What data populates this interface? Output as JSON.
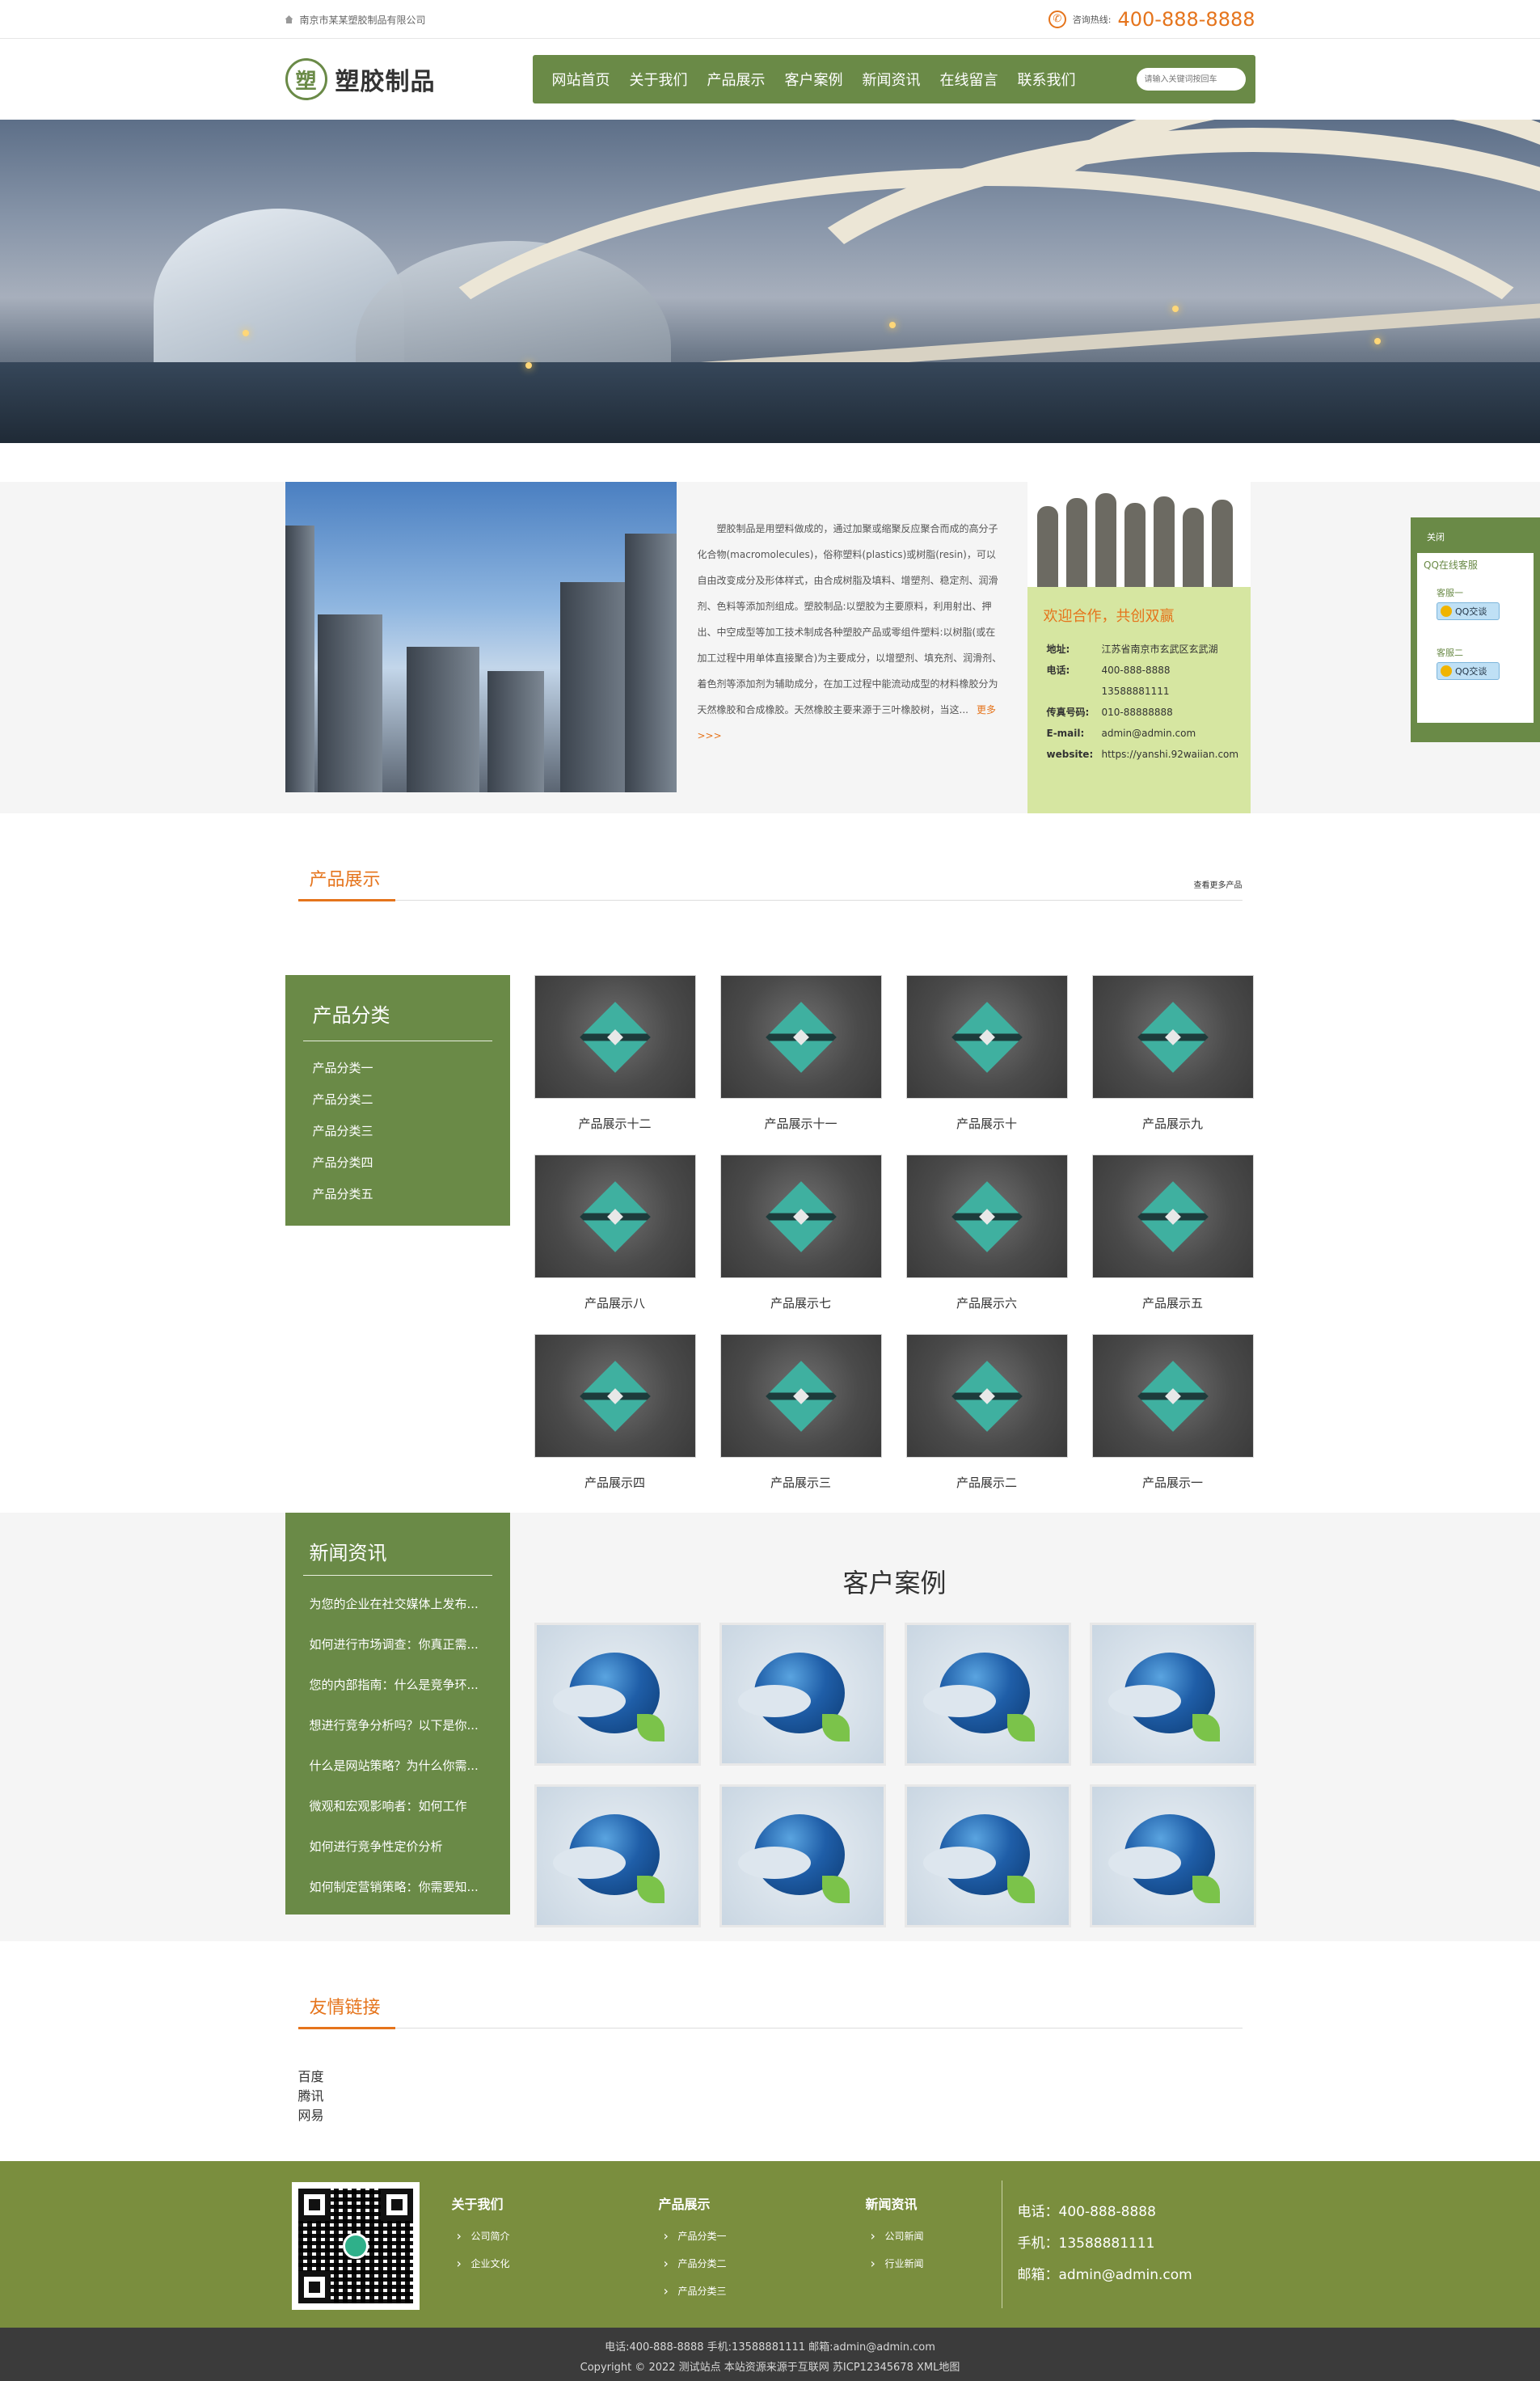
{
  "topbar": {
    "company": "南京市某某塑胶制品有限公司",
    "hotline_label": "咨询热线:",
    "hotline": "400-888-8888"
  },
  "header": {
    "logo_mark": "塑",
    "logo_text": "塑胶制品",
    "nav": [
      "网站首页",
      "关于我们",
      "产品展示",
      "客户案例",
      "新闻资讯",
      "在线留言",
      "联系我们"
    ],
    "search_placeholder": "请输入关键词按回车"
  },
  "about": {
    "text": "塑胶制品是用塑料做成的，通过加聚或缩聚反应聚合而成的高分子化合物(macromolecules)，俗称塑料(plastics)或树脂(resin)，可以自由改变成分及形体样式，由合成树脂及填料、增塑剂、稳定剂、润滑剂、色料等添加剂组成。塑胶制品:以塑胶为主要原料，利用射出、押出、中空成型等加工技术制成各种塑胶产品或零组件塑料:以树脂(或在加工过程中用单体直接聚合)为主要成分，以增塑剂、填充剂、润滑剂、着色剂等添加剂为辅助成分，在加工过程中能流动成型的材料橡胶分为天然橡胶和合成橡胶。天然橡胶主要来源于三叶橡胶树，当这...",
    "more": "更多>>>",
    "contact_title": "欢迎合作，共创双赢",
    "contact": [
      {
        "k": "地址:",
        "v": "江苏省南京市玄武区玄武湖"
      },
      {
        "k": "电话:",
        "v": "400-888-8888"
      },
      {
        "k": "",
        "v": "13588881111"
      },
      {
        "k": "传真号码:",
        "v": "010-88888888"
      },
      {
        "k": "E-mail:",
        "v": "admin@admin.com"
      },
      {
        "k": "website:",
        "v": "https://yanshi.92waiian.com"
      }
    ]
  },
  "qq": {
    "close": "关闭",
    "title": "QQ在线客服",
    "agents": [
      {
        "name": "客服一",
        "btn": "QQ交谈"
      },
      {
        "name": "客服二",
        "btn": "QQ交谈"
      }
    ]
  },
  "products": {
    "title": "产品展示",
    "more": "查看更多产品",
    "cat_title": "产品分类",
    "categories": [
      "产品分类一",
      "产品分类二",
      "产品分类三",
      "产品分类四",
      "产品分类五"
    ],
    "items": [
      "产品展示十二",
      "产品展示十一",
      "产品展示十",
      "产品展示九",
      "产品展示八",
      "产品展示七",
      "产品展示六",
      "产品展示五",
      "产品展示四",
      "产品展示三",
      "产品展示二",
      "产品展示一"
    ]
  },
  "news": {
    "title": "新闻资讯",
    "items": [
      "为您的企业在社交媒体上发布...",
      "如何进行市场调查：你真正需...",
      "您的内部指南：什么是竞争环...",
      "想进行竞争分析吗？以下是你...",
      "什么是网站策略？为什么你需...",
      "微观和宏观影响者：如何工作",
      "如何进行竞争性定价分析",
      "如何制定营销策略：你需要知..."
    ]
  },
  "cases": {
    "title": "客户案例",
    "count": 8
  },
  "links": {
    "title": "友情链接",
    "items": [
      "百度",
      "腾讯",
      "网易"
    ]
  },
  "footer": {
    "cols": [
      {
        "title": "关于我们",
        "items": [
          "公司简介",
          "企业文化"
        ]
      },
      {
        "title": "产品展示",
        "items": [
          "产品分类一",
          "产品分类二",
          "产品分类三"
        ]
      },
      {
        "title": "新闻资讯",
        "items": [
          "公司新闻",
          "行业新闻"
        ]
      }
    ],
    "phone": "电话：400-888-8888",
    "mobile": "手机：13588881111",
    "email": "邮箱：admin@admin.com",
    "bottom_line1": "电话:400-888-8888  手机:13588881111  邮箱:admin@admin.com",
    "bottom_line2": "Copyright © 2022 测试站点 本站资源来源于互联网  苏ICP12345678  XML地图"
  },
  "colors": {
    "primary": "#6a8a47",
    "accent": "#e5741c",
    "footer": "#7a8e3e",
    "contact_bg": "#d6e6a1"
  }
}
